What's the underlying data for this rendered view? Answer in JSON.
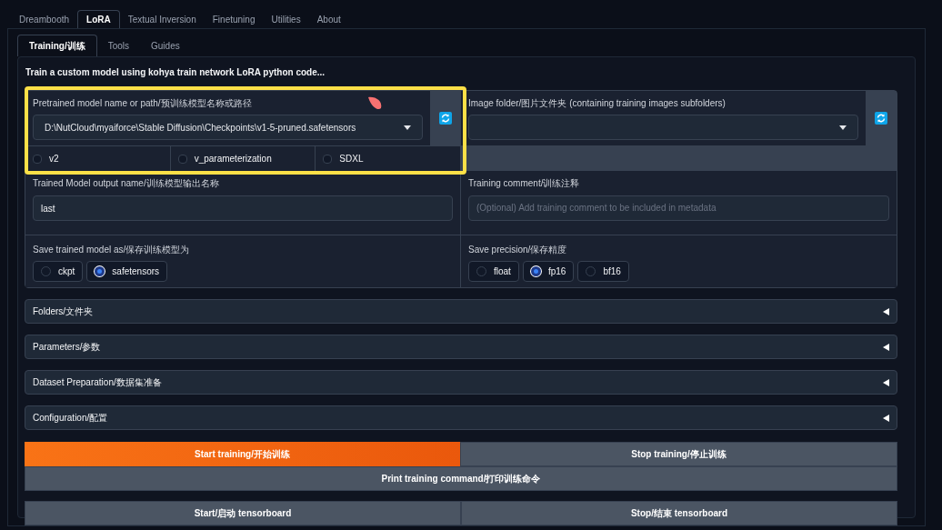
{
  "tabs": [
    {
      "label": "Dreambooth",
      "selected": false
    },
    {
      "label": "LoRA",
      "selected": true
    },
    {
      "label": "Textual Inversion",
      "selected": false
    },
    {
      "label": "Finetuning",
      "selected": false
    },
    {
      "label": "Utilities",
      "selected": false
    },
    {
      "label": "About",
      "selected": false
    }
  ],
  "subtabs": [
    {
      "label": "Training/训练",
      "selected": true
    },
    {
      "label": "Tools",
      "selected": false
    },
    {
      "label": "Guides",
      "selected": false
    }
  ],
  "description": "Train a custom model using kohya train network LoRA python code...",
  "model": {
    "label": "Pretrained model name or path/预训练模型名称或路径",
    "value": "D:\\NutCloud\\myaiforce\\Stable Diffusion\\Checkpoints\\v1-5-pruned.safetensors",
    "checkboxes": [
      {
        "label": "v2",
        "checked": false
      },
      {
        "label": "v_parameterization",
        "checked": false
      },
      {
        "label": "SDXL",
        "checked": false
      }
    ]
  },
  "image_folder": {
    "label": "Image folder/图片文件夹 (containing training images subfolders)"
  },
  "output_name": {
    "label": "Trained Model output name/训练模型输出名称",
    "value": "last"
  },
  "training_comment": {
    "label": "Training comment/训练注释",
    "placeholder": "(Optional) Add training comment to be included in metadata"
  },
  "save_as": {
    "label": "Save trained model as/保存训练模型为",
    "options": [
      {
        "label": "ckpt",
        "selected": false
      },
      {
        "label": "safetensors",
        "selected": true
      }
    ]
  },
  "save_precision": {
    "label": "Save precision/保存精度",
    "options": [
      {
        "label": "float",
        "selected": false
      },
      {
        "label": "fp16",
        "selected": true
      },
      {
        "label": "bf16",
        "selected": false
      }
    ]
  },
  "accordions": [
    {
      "label": "Folders/文件夹",
      "expanded": false
    },
    {
      "label": "Parameters/参数",
      "expanded": false
    },
    {
      "label": "Dataset Preparation/数据集准备",
      "expanded": false
    },
    {
      "label": "Configuration/配置",
      "expanded": false
    }
  ],
  "button_groups": [
    [
      {
        "label": "Start training/开始训练",
        "kind": "primary"
      },
      {
        "label": "Stop training/停止训练",
        "kind": "secondary"
      }
    ],
    [
      {
        "label": "Print training command/打印训练命令",
        "kind": "secondary"
      }
    ],
    [
      {
        "label": "Start/启动 tensorboard",
        "kind": "secondary"
      },
      {
        "label": "Stop/结束 tensorboard",
        "kind": "secondary"
      }
    ]
  ]
}
